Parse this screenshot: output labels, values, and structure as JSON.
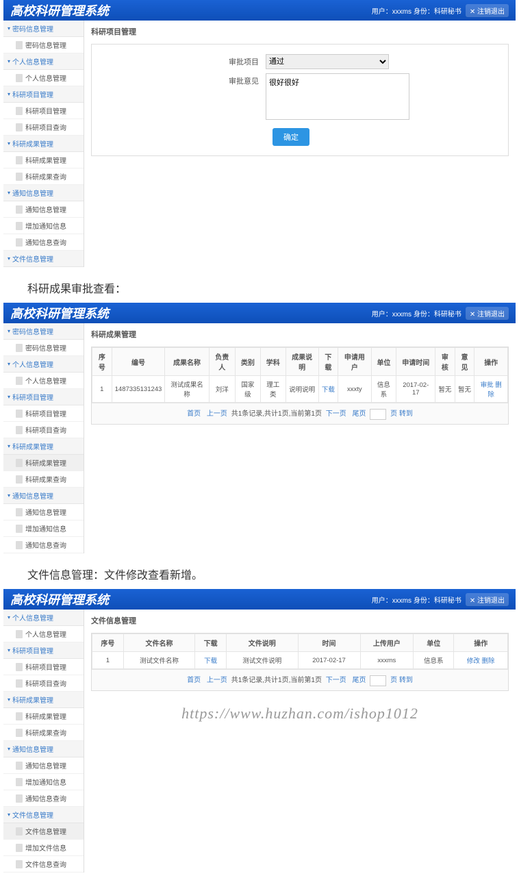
{
  "header": {
    "title": "高校科研管理系统",
    "user_text": "用户：xxxms 身份：科研秘书",
    "logout": "注销退出",
    "logout_icon": "✕"
  },
  "section_titles": {
    "result_review": "科研成果审批查看：",
    "file_mgmt": "文件信息管理：文件修改查看新增。"
  },
  "nav": {
    "g1": {
      "label": "密码信息管理",
      "items": [
        "密码信息管理"
      ]
    },
    "g2": {
      "label": "个人信息管理",
      "items": [
        "个人信息管理"
      ]
    },
    "g3": {
      "label": "科研项目管理",
      "items": [
        "科研项目管理",
        "科研项目查询"
      ]
    },
    "g4": {
      "label": "科研成果管理",
      "items": [
        "科研成果管理",
        "科研成果查询"
      ]
    },
    "g5": {
      "label": "通知信息管理",
      "items": [
        "通知信息管理",
        "增加通知信息",
        "通知信息查询"
      ]
    },
    "g6": {
      "label": "文件信息管理",
      "items": [
        "文件信息管理",
        "增加文件信息",
        "文件信息查询"
      ]
    }
  },
  "screen1": {
    "title": "科研项目管理",
    "label_project": "审批项目",
    "label_opinion": "审批意见",
    "select_value": "通过",
    "textarea_value": "很好很好",
    "submit": "确定"
  },
  "screen2": {
    "title": "科研成果管理",
    "headers": [
      "序号",
      "编号",
      "成果名称",
      "负责人",
      "类别",
      "学科",
      "成果说明",
      "下载",
      "申请用户",
      "单位",
      "申请时间",
      "审核",
      "意见",
      "操作"
    ],
    "row": [
      "1",
      "1487335131243",
      "测试成果名称",
      "刘洋",
      "国家级",
      "理工类",
      "说明说明",
      "下载",
      "xxxty",
      "信息系",
      "2017-02-17",
      "暂无",
      "暂无"
    ],
    "ops": {
      "a": "审批",
      "b": "删除"
    }
  },
  "screen3": {
    "title": "文件信息管理",
    "headers": [
      "序号",
      "文件名称",
      "下载",
      "文件说明",
      "时间",
      "上传用户",
      "单位",
      "操作"
    ],
    "row": [
      "1",
      "测试文件名称",
      "下载",
      "测试文件说明",
      "2017-02-17",
      "xxxms",
      "信息系"
    ],
    "ops": {
      "a": "修改",
      "b": "删除"
    }
  },
  "pagination": {
    "first": "首页",
    "prev": "上一页",
    "mid": "共1条记录,共计1页,当前第1页",
    "next": "下一页",
    "last": "尾页",
    "go": "页 转到"
  },
  "watermark": "https://www.huzhan.com/ishop1012"
}
